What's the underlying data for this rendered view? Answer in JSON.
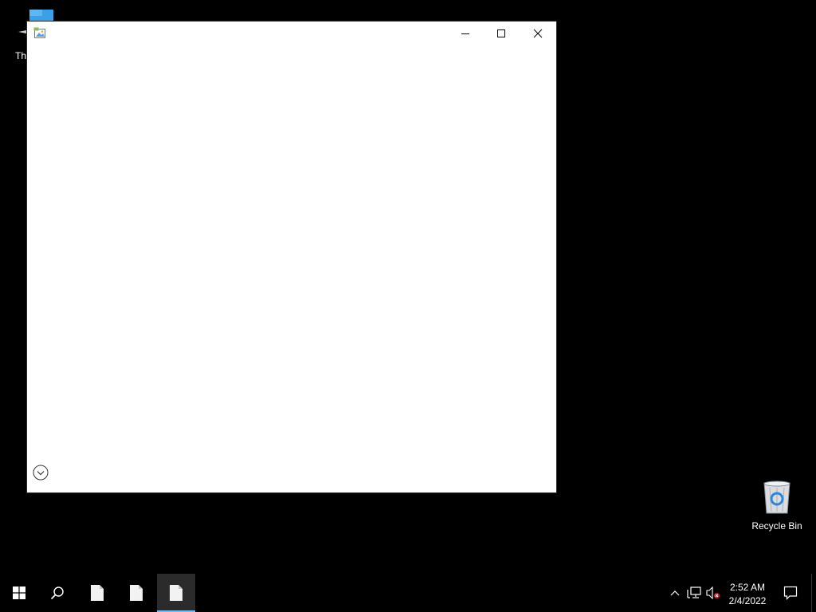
{
  "desktop": {
    "icons": [
      {
        "label": "This PC",
        "visible_label": "Thi",
        "icon": "this-pc-icon"
      },
      {
        "label": "Recycle Bin",
        "visible_label": "Recycle Bin",
        "icon": "recycle-bin-icon"
      }
    ]
  },
  "window": {
    "title": "",
    "app_icon": "image-app-icon",
    "controls": {
      "minimize": "minimize-icon",
      "maximize": "maximize-icon",
      "close": "close-icon"
    },
    "expand_button_icon": "chevron-down-circle-icon"
  },
  "taskbar": {
    "start_icon": "windows-logo-icon",
    "search_icon": "search-icon",
    "apps": [
      {
        "icon": "document-icon",
        "active": false
      },
      {
        "icon": "document-icon",
        "active": false
      },
      {
        "icon": "document-icon",
        "active": true
      }
    ],
    "tray": {
      "chevron_icon": "chevron-up-icon",
      "network_icon": "network-icon",
      "volume_icon": "volume-muted-icon"
    },
    "clock": {
      "time": "2:52 AM",
      "date": "2/4/2022"
    },
    "notifications_icon": "action-center-icon"
  },
  "colors": {
    "desktop_background": "#000000",
    "taskbar_background": "#000000",
    "accent": "#76b9ed",
    "window_background": "#ffffff"
  }
}
